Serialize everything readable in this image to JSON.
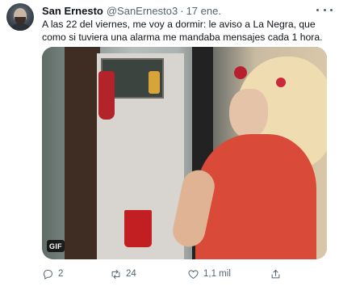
{
  "tweet": {
    "author_name": "San Ernesto",
    "handle": "@SanErnesto3",
    "separator": "·",
    "date": "17 ene.",
    "text": "A las 22 del viernes, me voy a dormir: le aviso a La Negra, que como si tuviera una alarma me mandaba mensajes cada 1 hora.",
    "media": {
      "badge": "GIF"
    },
    "actions": {
      "reply_count": "2",
      "retweet_count": "24",
      "like_count": "1,1 mil"
    },
    "icons": {
      "reply": "reply-icon",
      "retweet": "retweet-icon",
      "like": "heart-icon",
      "share": "share-icon",
      "more": "more-icon"
    }
  }
}
